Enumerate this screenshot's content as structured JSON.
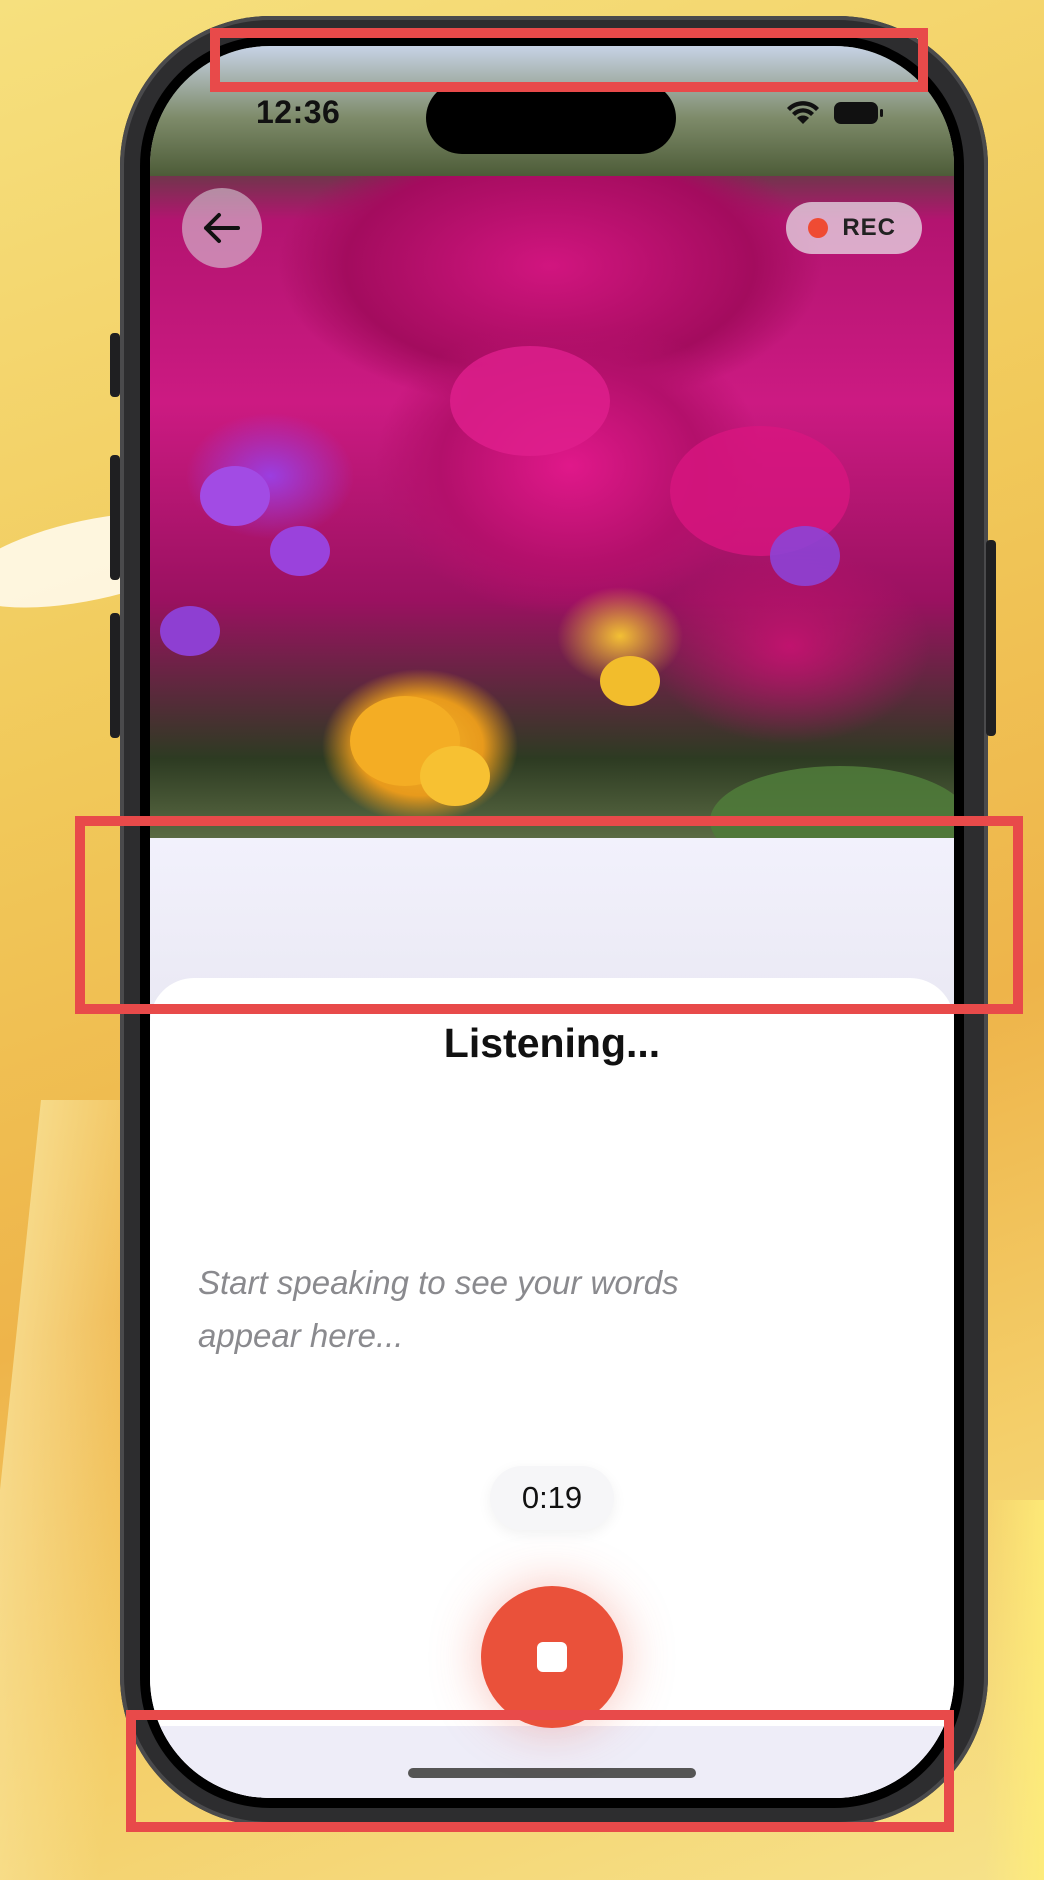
{
  "status_bar": {
    "time": "12:36",
    "wifi_icon": "wifi-icon",
    "battery_icon": "battery-icon"
  },
  "header": {
    "back_icon": "arrow-left-icon",
    "rec_label": "REC",
    "rec_color": "#ef4b33"
  },
  "sheet": {
    "title": "Listening...",
    "placeholder": "Start speaking to see your words appear here...",
    "timer": "0:19",
    "stop_icon": "stop-icon",
    "stop_color": "#ea513a"
  },
  "annotation_color": "#e84a4a"
}
